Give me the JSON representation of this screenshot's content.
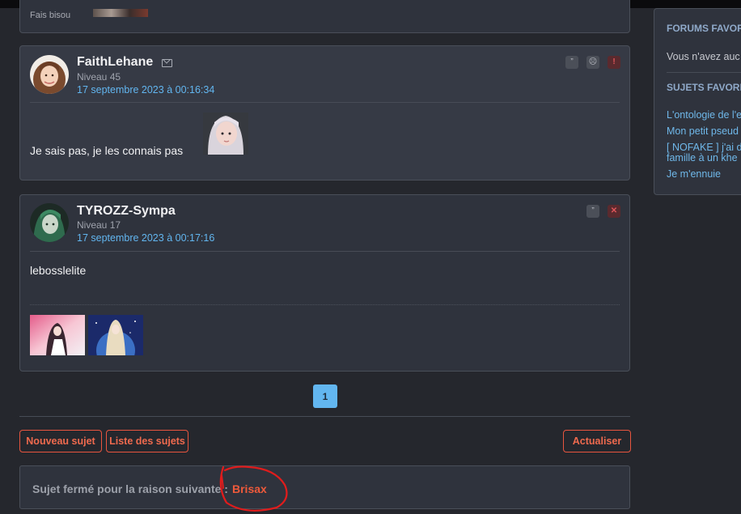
{
  "posts": [
    {
      "fragment_text": "Fais bisou"
    },
    {
      "author": "FaithLehane",
      "level": "Niveau 45",
      "date": "17 septembre 2023 à 00:16:34",
      "message": "Je sais pas, je les connais pas",
      "actions": [
        "quote-icon",
        "sad-icon",
        "report-icon"
      ]
    },
    {
      "author": "TYROZZ-Sympa",
      "level": "Niveau 17",
      "date": "17 septembre 2023 à 00:17:16",
      "message": "lebosslelite",
      "actions": [
        "quote-icon",
        "close-icon"
      ]
    }
  ],
  "pagination": {
    "current": "1"
  },
  "buttons": {
    "new_topic": "Nouveau sujet",
    "topic_list": "Liste des sujets",
    "refresh": "Actualiser"
  },
  "closed": {
    "label": "Sujet fermé pour la raison suivante :",
    "reason": "Brisax"
  },
  "sidebar": {
    "forums_title": "FORUMS FAVOR",
    "forums_empty": "Vous n'avez auc",
    "topics_title": "SUJETS FAVORI",
    "topics": [
      "L'ontologie de l'e",
      "Mon petit pseud",
      "[ NOFAKE ] j'ai de\nfamille à un khe",
      "Je m'ennuie"
    ]
  },
  "colors": {
    "accent_link": "#62b6f0",
    "button_accent": "#ef6a4e",
    "panel": "#2f333d",
    "background": "#25272d"
  }
}
